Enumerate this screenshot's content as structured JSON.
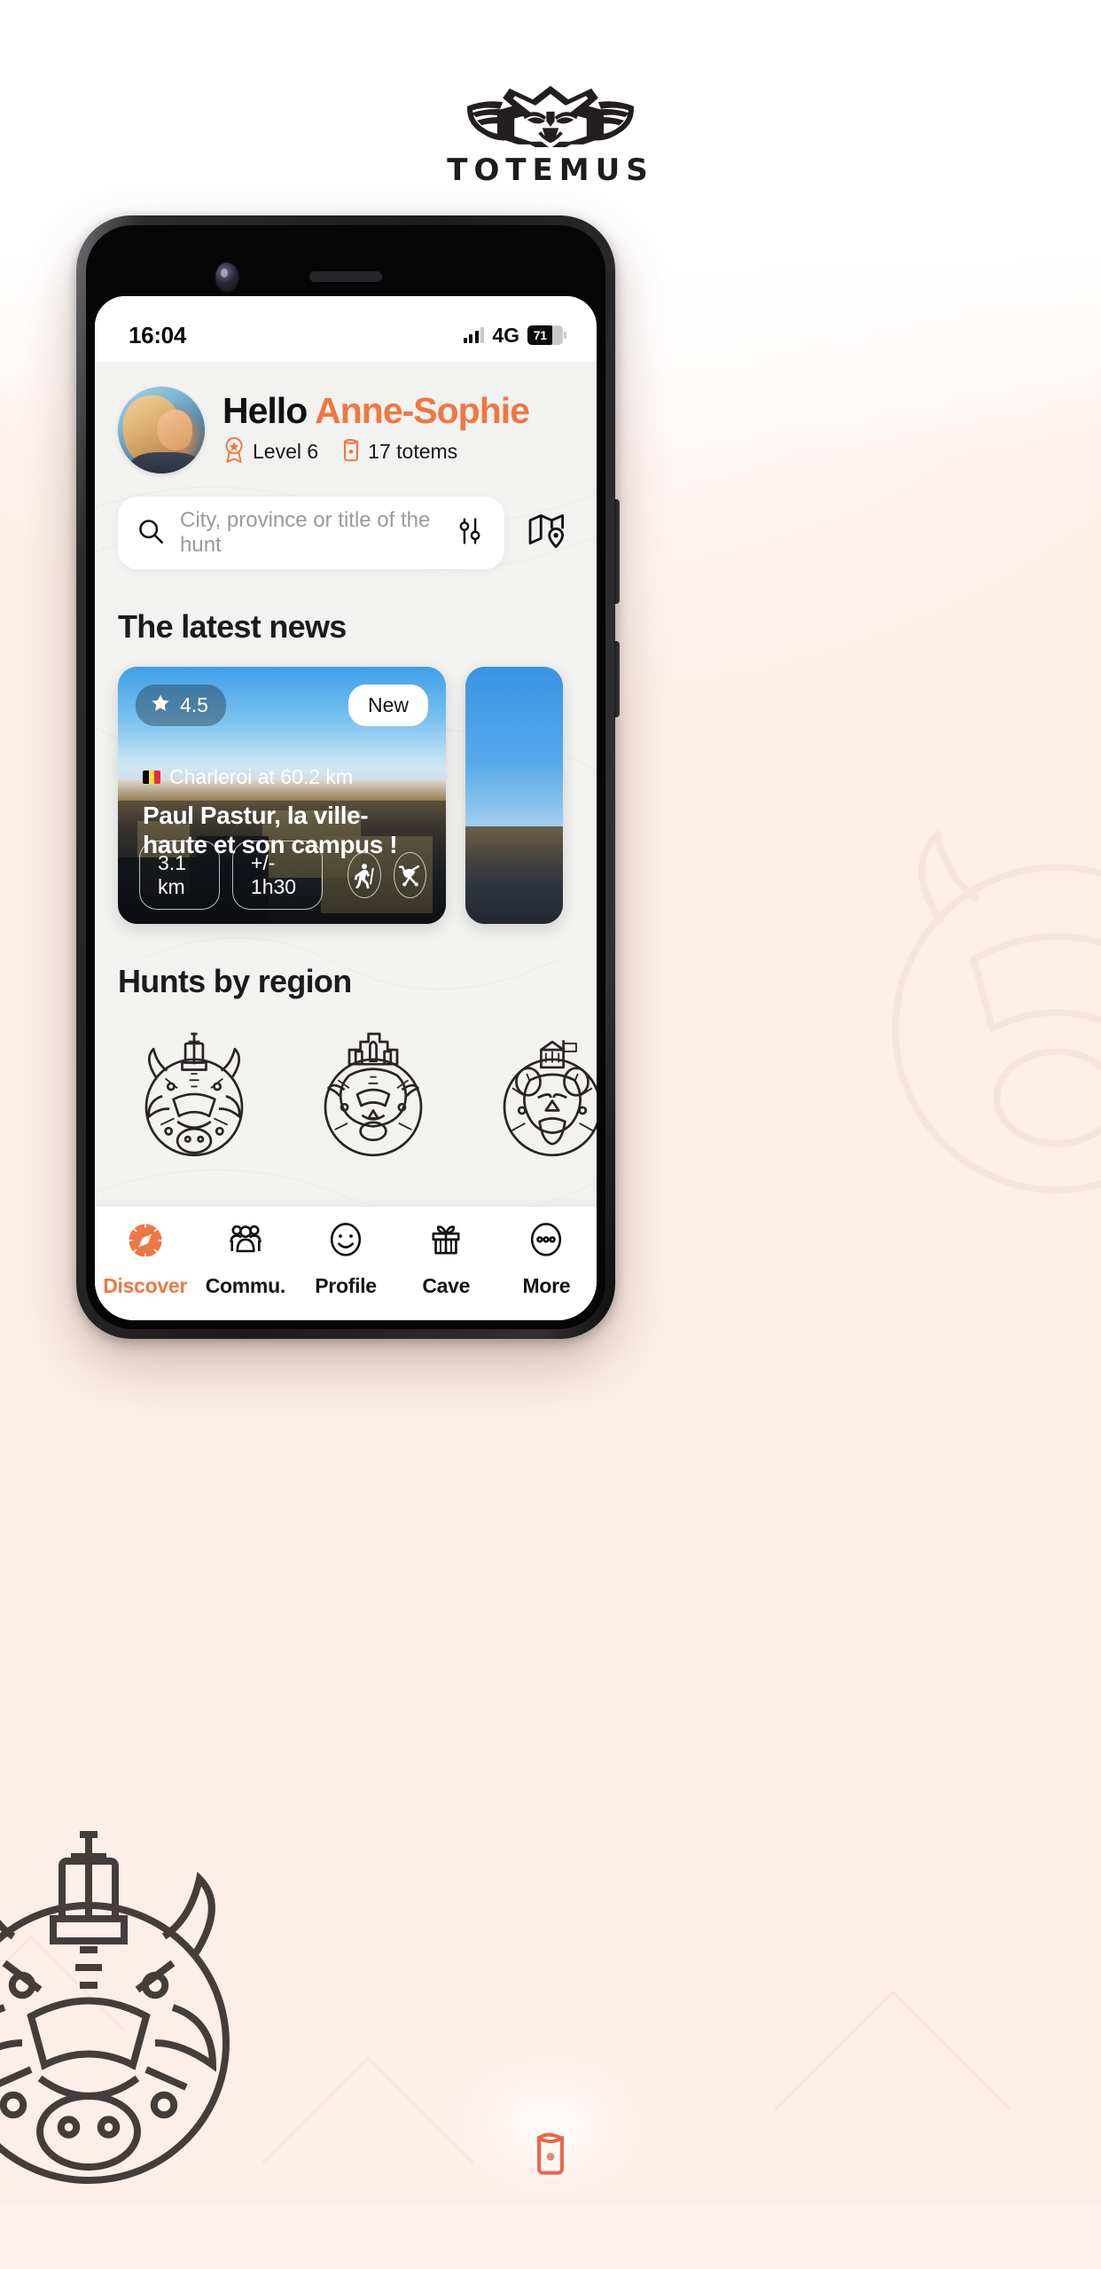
{
  "brand": {
    "wordmark": "TOTEMUS",
    "logo_icon": "totemus-owl-mask-logo"
  },
  "status_bar": {
    "time": "16:04",
    "network": "4G",
    "battery_percent": "71",
    "signal_icon": "signal-bars-icon",
    "battery_icon": "battery-icon"
  },
  "greeting": {
    "hello": "Hello",
    "name": "Anne-Sophie",
    "level": "Level 6",
    "totems": "17 totems",
    "level_icon": "award-badge-icon",
    "totems_icon": "totem-icon",
    "avatar": "user-avatar"
  },
  "search": {
    "placeholder": "City, province or title of the hunt",
    "value": "",
    "search_icon": "search-icon",
    "filter_icon": "filter-sliders-icon",
    "map_icon": "map-pin-icon"
  },
  "sections": {
    "news_title": "The latest news",
    "regions_title": "Hunts by region"
  },
  "news": [
    {
      "rating": "4.5",
      "badge": "New",
      "location": "Charleroi at 60.2 km",
      "title": "Paul Pastur, la ville-haute et son campus !",
      "distance": "3.1 km",
      "duration": "+/- 1h30",
      "star_icon": "star-icon",
      "flag_icon": "belgium-flag-icon",
      "hiker_icon": "hiker-icon",
      "stroller_icon": "stroller-icon"
    }
  ],
  "regions": [
    {
      "icon": "bull-totem-icon"
    },
    {
      "icon": "lion-totem-icon"
    },
    {
      "icon": "bear-totem-icon"
    },
    {
      "icon": "partial-totem-icon"
    }
  ],
  "tabs": [
    {
      "label": "Discover",
      "icon": "compass-icon",
      "active": true
    },
    {
      "label": "Commu.",
      "icon": "people-icon",
      "active": false
    },
    {
      "label": "Profile",
      "icon": "smiley-icon",
      "active": false
    },
    {
      "label": "Cave",
      "icon": "gift-icon",
      "active": false
    },
    {
      "label": "More",
      "icon": "more-dots-icon",
      "active": false
    }
  ],
  "colors": {
    "accent": "#ef7742",
    "text": "#151515",
    "app_bg": "#f2f2f0",
    "page_bg": "#fdf1ee"
  }
}
